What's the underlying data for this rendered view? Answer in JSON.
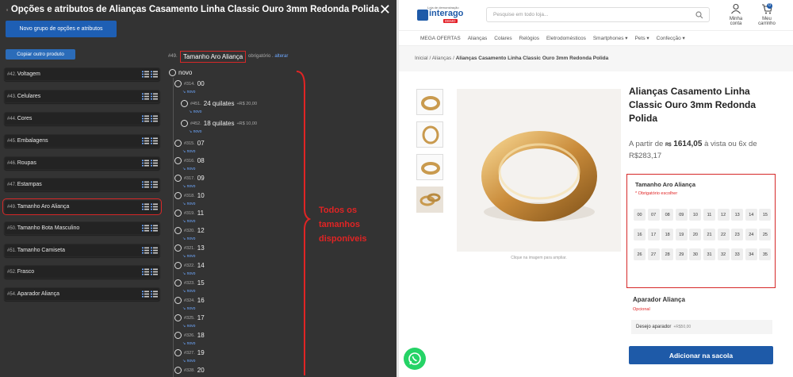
{
  "modal": {
    "title": "Opções e atributos de Alianças Casamento Linha Classic Ouro 3mm Redonda Polida",
    "new_group_label": "Novo grupo de opções e atributos",
    "copy_label": "Copiar outro produto",
    "groups": [
      {
        "id": "#42.",
        "name": "Voltagem"
      },
      {
        "id": "#43.",
        "name": "Celulares"
      },
      {
        "id": "#44.",
        "name": "Cores"
      },
      {
        "id": "#45.",
        "name": "Embalagens"
      },
      {
        "id": "#46.",
        "name": "Roupas"
      },
      {
        "id": "#47.",
        "name": "Estampas"
      },
      {
        "id": "#49.",
        "name": "Tamanho Aro Aliança"
      },
      {
        "id": "#50.",
        "name": "Tamanho Bota Masculino"
      },
      {
        "id": "#51.",
        "name": "Tamanho Camiseta"
      },
      {
        "id": "#52.",
        "name": "Frasco"
      },
      {
        "id": "#54.",
        "name": "Aparador Aliança"
      }
    ],
    "selected": {
      "prefix": "#49.",
      "name": "Tamanho Aro Aliança",
      "required": "obrigatório .",
      "edit": "alterar"
    },
    "new_root": "novo",
    "new_sub": "↘ novo",
    "options": [
      {
        "id": "#314.",
        "name": "00"
      },
      {
        "id": "#451.",
        "name": "24 quilates",
        "price": "+R$ 20,00",
        "child": true
      },
      {
        "id": "#452.",
        "name": "18 quilates",
        "price": "+R$ 10,00",
        "child": true
      },
      {
        "id": "#315.",
        "name": "07"
      },
      {
        "id": "#316.",
        "name": "08"
      },
      {
        "id": "#317.",
        "name": "09"
      },
      {
        "id": "#318.",
        "name": "10"
      },
      {
        "id": "#319.",
        "name": "11"
      },
      {
        "id": "#320.",
        "name": "12"
      },
      {
        "id": "#321.",
        "name": "13"
      },
      {
        "id": "#322.",
        "name": "14"
      },
      {
        "id": "#323.",
        "name": "15"
      },
      {
        "id": "#324.",
        "name": "16"
      },
      {
        "id": "#325.",
        "name": "17"
      },
      {
        "id": "#326.",
        "name": "18"
      },
      {
        "id": "#327.",
        "name": "19"
      },
      {
        "id": "#328.",
        "name": "20"
      }
    ],
    "annotation": "Todos os tamanhos disponíveis"
  },
  "store": {
    "logo_caption": "Loja de demonstração",
    "logo_word": "interago",
    "logo_badge": "DEMO",
    "search_placeholder": "Pesquise em todo loja...",
    "account_label": "Minha conta",
    "cart_label": "Meu carrinho",
    "cart_count": "0",
    "nav": [
      "MEGA OFERTAS",
      "Alianças",
      "Colares",
      "Relógios",
      "Eletrodomésticos",
      "Smartphones ▾",
      "Pets ▾",
      "Confecção ▾"
    ],
    "crumbs": {
      "home": "Inicial",
      "sep": "/",
      "cat": "Alianças",
      "current": "Alianças Casamento Linha Classic Ouro 3mm Redonda Polida"
    },
    "zoom_hint": "Clique na imagem para ampliar.",
    "product_title": "Alianças Casamento Linha Classic Ouro 3mm Redonda Polida",
    "price_from": "A partir de",
    "price_currency": "R$",
    "price_value": "1614,05",
    "price_rest": "à vista ou 6x de R$283,17",
    "size_title": "Tamanho Aro Aliança",
    "size_required": "* Obrigatório escolher",
    "sizes": [
      "00",
      "07",
      "08",
      "09",
      "10",
      "11",
      "12",
      "13",
      "14",
      "15",
      "16",
      "17",
      "18",
      "19",
      "20",
      "21",
      "22",
      "23",
      "24",
      "25",
      "26",
      "27",
      "28",
      "29",
      "30",
      "31",
      "32",
      "33",
      "34",
      "35"
    ],
    "acc_title": "Aparador Aliança",
    "acc_optional": "Opcional",
    "acc_item": "Desejo aparador",
    "acc_price": "+R$50,00",
    "add_label": "Adicionar na sacola"
  },
  "colors": {
    "accent": "#1e5aa8",
    "alert": "#d62828",
    "modal_bg": "#333333"
  }
}
